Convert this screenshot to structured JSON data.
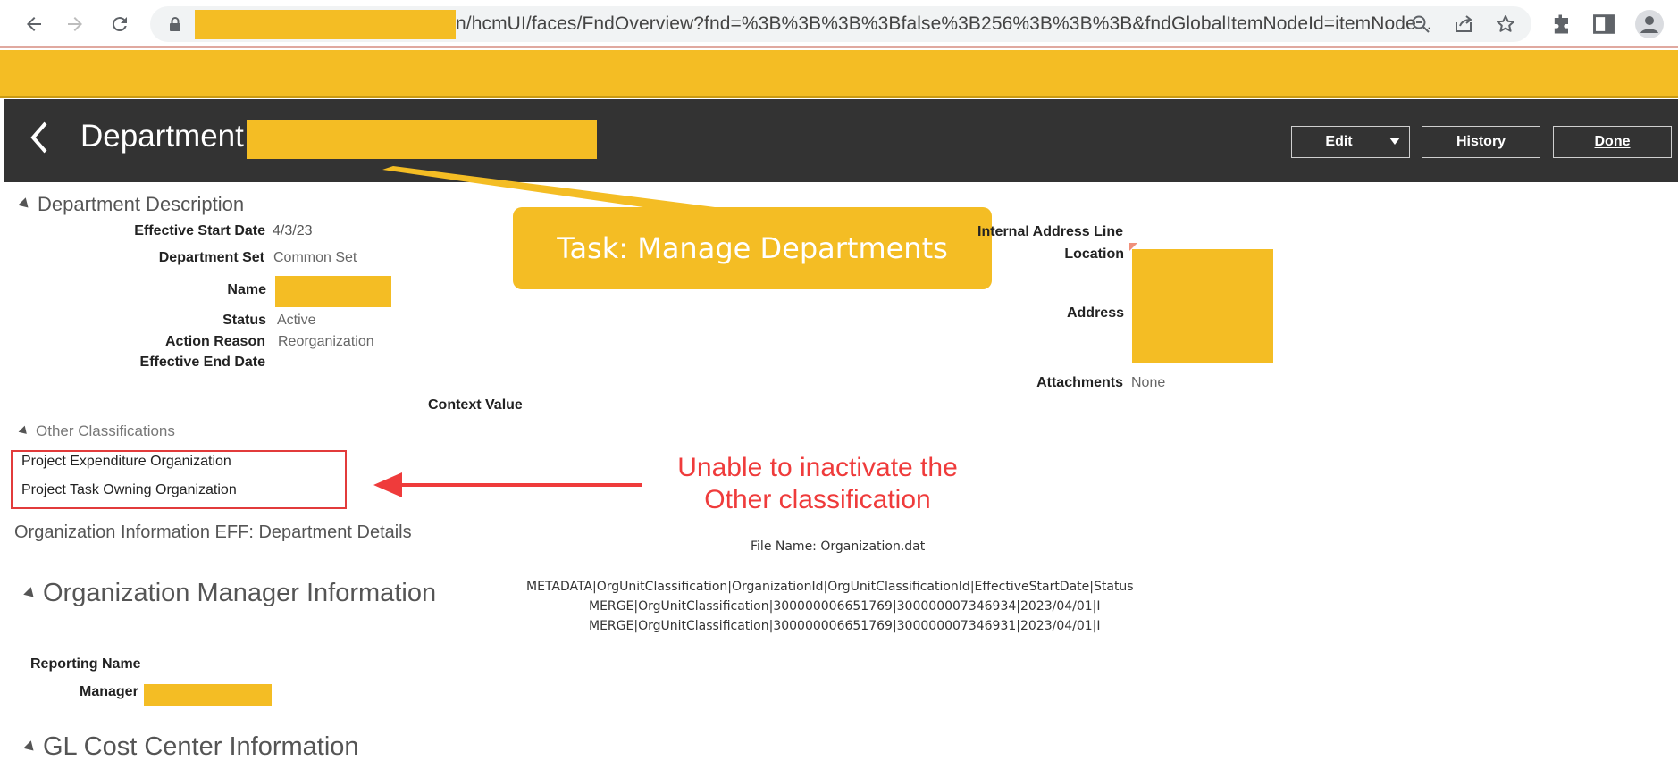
{
  "browser": {
    "url_visible": "n/hcmUI/faces/FndOverview?fnd=%3B%3B%3B%3Bfalse%3B256%3B%3B%3B&fndGlobalItemNodeId=itemNode...",
    "icons": [
      "back-arrow-icon",
      "forward-arrow-icon",
      "reload-icon",
      "lock-icon",
      "zoom-out-icon",
      "share-icon",
      "star-icon",
      "extensions-puzzle-icon",
      "side-panel-icon",
      "profile-icon"
    ]
  },
  "header": {
    "title": "Department:",
    "buttons": {
      "edit": "Edit",
      "history": "History",
      "done": "Done"
    }
  },
  "callout": {
    "text": "Task: Manage Departments"
  },
  "department_description": {
    "section_title": "Department Description",
    "fields": {
      "effective_start_date": {
        "label": "Effective Start Date",
        "value": "4/3/23"
      },
      "department_set": {
        "label": "Department Set",
        "value": "Common Set"
      },
      "name": {
        "label": "Name"
      },
      "status": {
        "label": "Status",
        "value": "Active"
      },
      "action_reason": {
        "label": "Action Reason",
        "value": "Reorganization"
      },
      "effective_end_date": {
        "label": "Effective End Date"
      },
      "context_value": {
        "label": "Context Value"
      }
    },
    "right_fields": {
      "internal_address_line": {
        "label": "Internal Address Line"
      },
      "location": {
        "label": "Location"
      },
      "address": {
        "label": "Address"
      },
      "attachments": {
        "label": "Attachments",
        "value": "None"
      }
    }
  },
  "other_classifications": {
    "section_title": "Other Classifications",
    "items": [
      "Project Expenditure Organization",
      "Project Task Owning Organization"
    ]
  },
  "annotation": {
    "line1": "Unable to inactivate the",
    "line2": "Other classification"
  },
  "org_info_eff": {
    "title": "Organization Information EFF: Department Details"
  },
  "file_info": {
    "file_name": "File Name: Organization.dat",
    "lines": [
      "METADATA|OrgUnitClassification|OrganizationId|OrgUnitClassificationId|EffectiveStartDate|Status",
      "MERGE|OrgUnitClassification|300000006651769|300000007346934|2023/04/01|I",
      "MERGE|OrgUnitClassification|300000006651769|300000007346931|2023/04/01|I"
    ]
  },
  "org_manager_info": {
    "section_title": "Organization Manager Information",
    "reporting_name_label": "Reporting Name",
    "manager_label": "Manager"
  },
  "gl_cost_center": {
    "section_title": "GL Cost Center Information"
  },
  "colors": {
    "highlight": "#f4bd24",
    "dark_header": "#333333",
    "annotation_red": "#ef3b3b"
  }
}
